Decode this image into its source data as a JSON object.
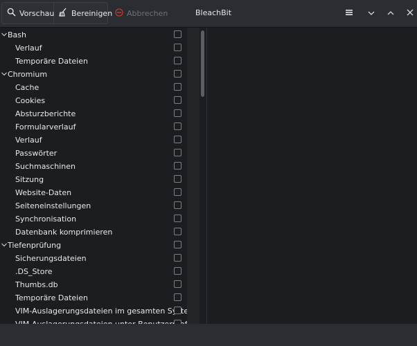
{
  "window": {
    "title": "BleachBit"
  },
  "toolbar": {
    "preview_label": "Vorschau",
    "clean_label": "Bereinigen",
    "abort_label": "Abbrechen"
  },
  "tree": [
    {
      "label": "Bash",
      "level": 0
    },
    {
      "label": "Verlauf",
      "level": 1
    },
    {
      "label": "Temporäre Dateien",
      "level": 1
    },
    {
      "label": "Chromium",
      "level": 0
    },
    {
      "label": "Cache",
      "level": 1
    },
    {
      "label": "Cookies",
      "level": 1
    },
    {
      "label": "Absturzberichte",
      "level": 1
    },
    {
      "label": "Formularverlauf",
      "level": 1
    },
    {
      "label": "Verlauf",
      "level": 1
    },
    {
      "label": "Passwörter",
      "level": 1
    },
    {
      "label": "Suchmaschinen",
      "level": 1
    },
    {
      "label": "Sitzung",
      "level": 1
    },
    {
      "label": "Website-Daten",
      "level": 1
    },
    {
      "label": "Seiteneinstellungen",
      "level": 1
    },
    {
      "label": "Synchronisation",
      "level": 1
    },
    {
      "label": "Datenbank komprimieren",
      "level": 1
    },
    {
      "label": "Tiefenprüfung",
      "level": 0
    },
    {
      "label": "Sicherungsdateien",
      "level": 1
    },
    {
      "label": ".DS_Store",
      "level": 1
    },
    {
      "label": "Thumbs.db",
      "level": 1
    },
    {
      "label": "Temporäre Dateien",
      "level": 1
    },
    {
      "label": "VIM-Auslagerungsdateien im gesamten System",
      "level": 1
    },
    {
      "label": "VIM-Auslagerungsdateien unter Benutzerprofil",
      "level": 1
    }
  ]
}
